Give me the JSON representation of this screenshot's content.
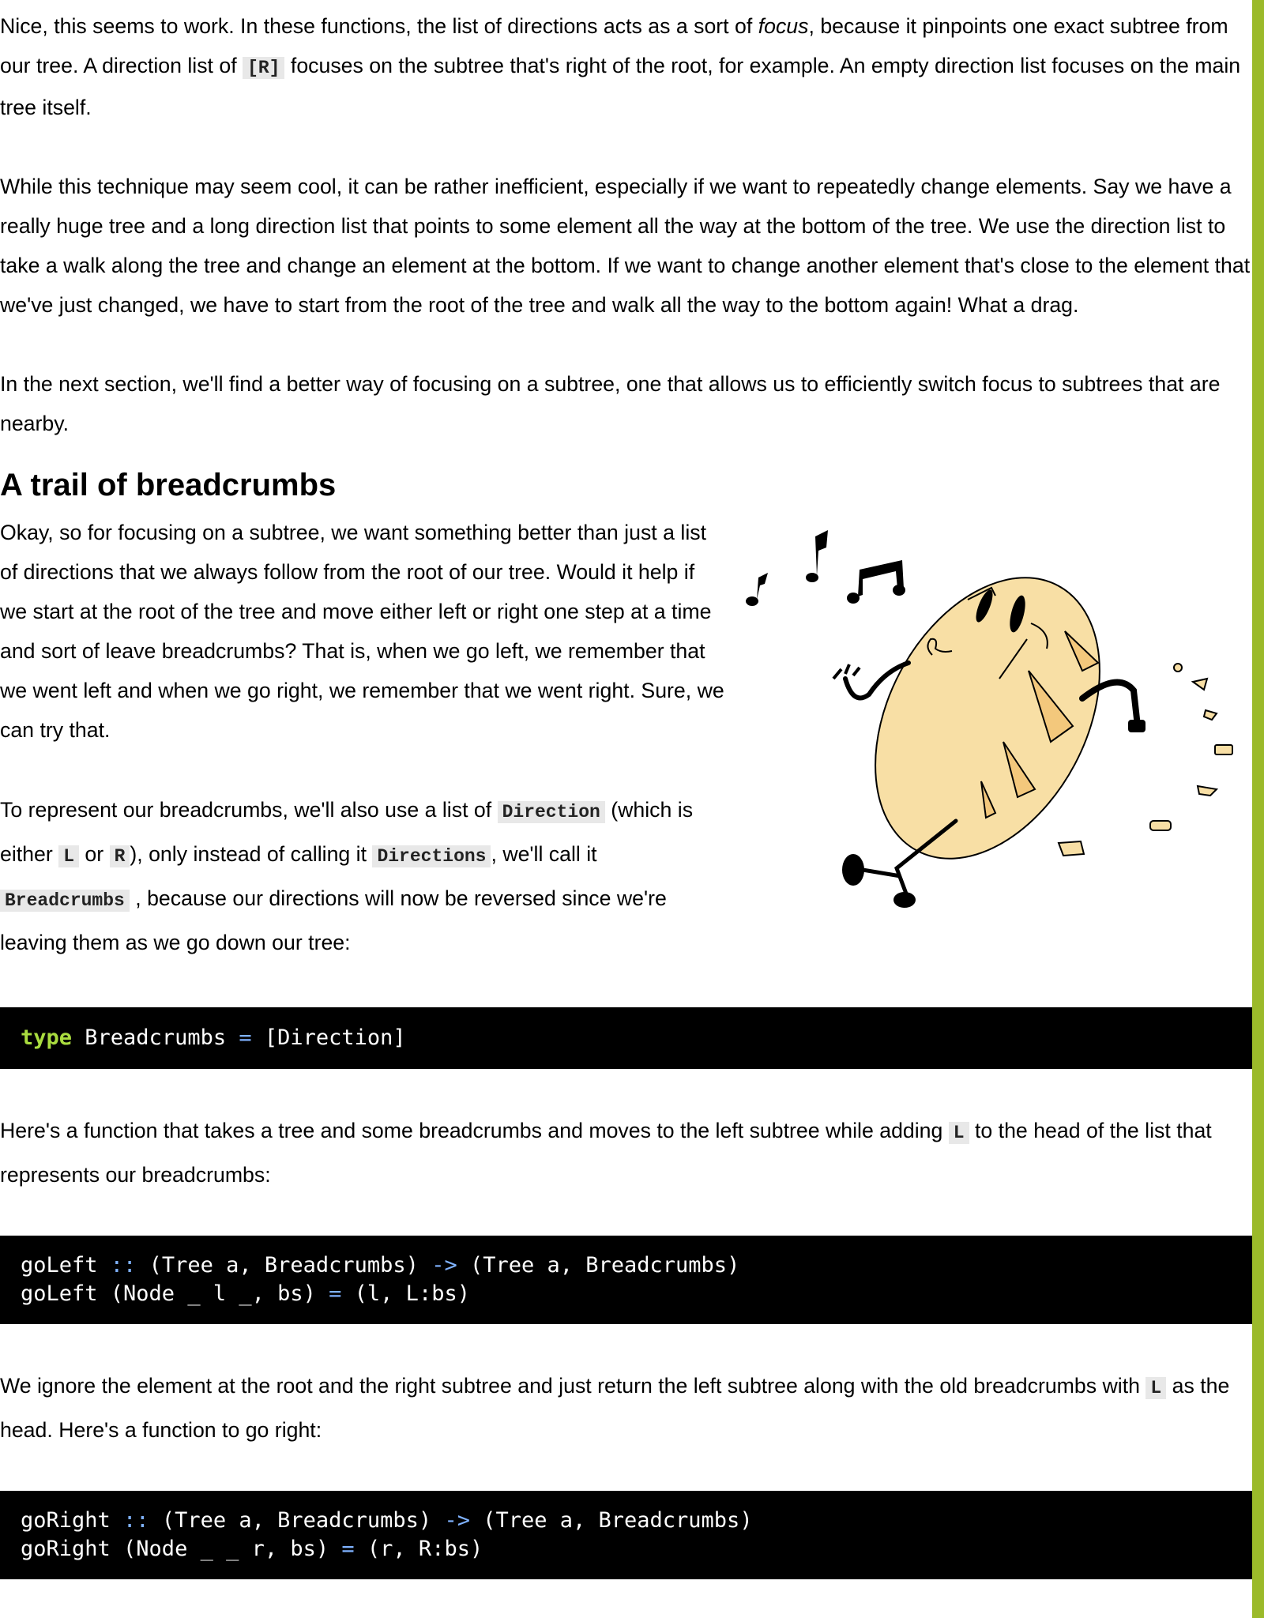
{
  "intro": {
    "p1_a": "Nice, this seems to work. In these functions, the list of directions acts as a sort of ",
    "p1_em": "focus",
    "p1_b": ", because it pinpoints one exact subtree from our tree. A direction list of ",
    "p1_code": "[R]",
    "p1_c": " focuses on the subtree that's right of the root, for example. An empty direction list focuses on the main tree itself.",
    "p2": "While this technique may seem cool, it can be rather inefficient, especially if we want to repeatedly change elements. Say we have a really huge tree and a long direction list that points to some element all the way at the bottom of the tree. We use the direction list to take a walk along the tree and change an element at the bottom. If we want to change another element that's close to the element that we've just changed, we have to start from the root of the tree and walk all the way to the bottom again! What a drag.",
    "p3": "In the next section, we'll find a better way of focusing on a subtree, one that allows us to efficiently switch focus to subtrees that are nearby."
  },
  "section": {
    "heading": "A trail of breadcrumbs",
    "p1": "Okay, so for focusing on a subtree, we want something better than just a list of directions that we always follow from the root of our tree. Would it help if we start at the root of the tree and move either left or right one step at a time and sort of leave breadcrumbs? That is, when we go left, we remember that we went left and when we go right, we remember that we went right. Sure, we can try that.",
    "p2_a": "To represent our breadcrumbs, we'll also use a list of ",
    "p2_code1": "Direction",
    "p2_b": " (which is either ",
    "p2_code2": "L",
    "p2_c": " or ",
    "p2_code3": "R",
    "p2_d": "), only instead of calling it ",
    "p2_code4": "Directions",
    "p2_e": ", we'll call it ",
    "p2_code5": "Breadcrumbs",
    "p2_f": " , because our directions will now be reversed since we're leaving them as we go down our tree:"
  },
  "code1": {
    "kw": "type",
    "rest": " Breadcrumbs ",
    "eq": "=",
    "tail": " [Direction]"
  },
  "para_left": {
    "a": "Here's a function that takes a tree and some breadcrumbs and moves to the left subtree while adding ",
    "code": "L",
    "b": " to the head of the list that represents our breadcrumbs:"
  },
  "code2": {
    "l1_a": "goLeft ",
    "l1_op1": "::",
    "l1_b": " (Tree a, Breadcrumbs) ",
    "l1_op2": "->",
    "l1_c": " (Tree a, Breadcrumbs)",
    "l2_a": "goLeft (Node _ l _, bs) ",
    "l2_eq": "=",
    "l2_b": " (l, L:bs)"
  },
  "para_right": {
    "a": "We ignore the element at the root and the right subtree and just return the left subtree along with the old breadcrumbs with ",
    "code": "L",
    "b": " as the head. Here's a function to go right:"
  },
  "code3": {
    "l1_a": "goRight ",
    "l1_op1": "::",
    "l1_b": " (Tree a, Breadcrumbs) ",
    "l1_op2": "->",
    "l1_c": " (Tree a, Breadcrumbs)",
    "l2_a": "goRight (Node _ _ r, bs) ",
    "l2_eq": "=",
    "l2_b": " (r, R:bs)"
  }
}
